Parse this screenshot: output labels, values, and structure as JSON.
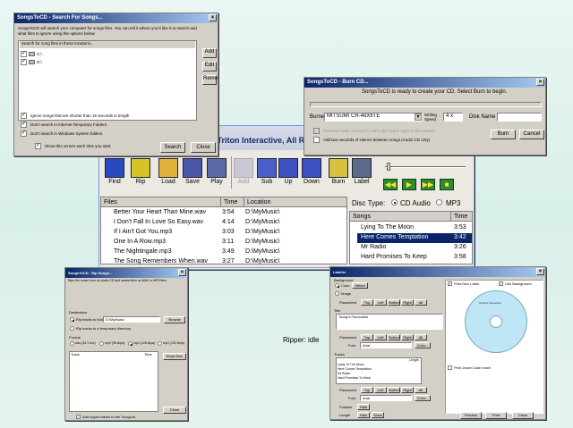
{
  "main": {
    "title_fragment": "4 Triton Interactive, All R",
    "toolbar": {
      "find": "Find",
      "rip": "Rip",
      "load": "Load",
      "save": "Save",
      "play": "Play",
      "add": "Add",
      "sub": "Sub",
      "up": "Up",
      "down": "Down",
      "burn": "Burn",
      "label": "Label"
    },
    "files": {
      "headers": [
        "Files",
        "Time",
        "Location"
      ],
      "rows": [
        [
          "Better Your Heart Than Mine.wav",
          "3:54",
          "D:\\MyMusic\\"
        ],
        [
          "I Don't Fall In Love So Easy.wav",
          "4:14",
          "D:\\MyMusic\\"
        ],
        [
          "If I Ain't Got You.mp3",
          "3:03",
          "D:\\MyMusic\\"
        ],
        [
          "One In A Row.mp3",
          "3:11",
          "D:\\MyMusic\\"
        ],
        [
          "The Nightingale.mp3",
          "3:49",
          "D:\\MyMusic\\"
        ],
        [
          "The Song Remembers When.wav",
          "3:27",
          "D:\\MyMusic\\"
        ]
      ]
    },
    "disc_type": {
      "label": "Disc Type:",
      "cd_audio": "CD Audio",
      "mp3": "MP3"
    },
    "songs": {
      "headers": [
        "Songs",
        "Time"
      ],
      "rows": [
        [
          "Lying To The Moon",
          "3:53"
        ],
        [
          "Here Comes Temptation",
          "3:42"
        ],
        [
          "Mr Radio",
          "3:26"
        ],
        [
          "Hard Promises To Keep",
          "3:58"
        ]
      ],
      "selected_index": 1
    },
    "status": "Ripper: idle"
  },
  "search": {
    "title": "SongsToCD - Search For Songs...",
    "intro": "SongsToCD will search your computer for songs files. You can tell it where you'd like it to search and what files to ignore using the options below",
    "list_header": "Search for song files in these locations...",
    "locations": [
      "C:\\",
      "D:\\"
    ],
    "add": "Add",
    "edit": "Edit",
    "remove": "Remove",
    "opt1": "Ignore songs that are shorter than 15 seconds in length",
    "opt2": "Don't search in Internet Temporary Folders",
    "opt3": "Don't search in Windows System folders",
    "opt4": "Show this screen each time you start",
    "search_btn": "Search",
    "close_btn": "Close"
  },
  "burn": {
    "title": "SongsToCD - Burn CD...",
    "ready": "SongsToCD is ready to create your CD. Select Burn to begin.",
    "burner_label": "Burner",
    "burner_value": "MITSUMI CR-48X8TE",
    "speed_label": "Writing Speed",
    "speed_value": "4 x",
    "disc_name_label": "Disk Name",
    "opt1": "Preserve order of songs in MP3 disc (adds digits to file names)",
    "opt2": "Add two seconds of silence between songs (Audio CD only)",
    "burn_btn": "Burn",
    "cancel_btn": "Cancel"
  },
  "rip": {
    "title": "SongsToCD - Rip Songs...",
    "intro": "Rips the music from an audio CD and saves them as WAV or MP3 files",
    "destination": "Destination",
    "rip_to_folder": "Rip tracks to folder",
    "folder": "D:\\MyMusic",
    "browse": "Browse",
    "temp": "Rip tracks to a temporary directory",
    "format": "Format",
    "formats": [
      "wav (44.1 khz)",
      "mp3 (96 kbps)",
      "mp3 (128 kbps)",
      "mp3 (192 kbps)"
    ],
    "track_col": "Track",
    "time_col": "Time",
    "read_disc": "Read Disc",
    "close": "Close",
    "add_tracks": "Add ripped tracks to the SongList"
  },
  "labeler": {
    "title": "Labeler",
    "background": "Background",
    "color": "Color",
    "image": "Image",
    "select": "Select",
    "placement": "Placement",
    "positions": [
      "Top",
      "Left",
      "Bottom",
      "Right",
      "All"
    ],
    "title_sec": "Title",
    "title_text": "Today's Favourites",
    "font_label": "Font",
    "font_value": "Arial",
    "color_btn": "Color...",
    "tracks": "Tracks",
    "track_list": [
      "Lying To The Moon",
      "Here Comes Temptation",
      "Mr Radio",
      "Hard Promises To Keep"
    ],
    "length_col": "Length",
    "position": "Position",
    "hide": "Hide",
    "show": "Show",
    "print_disc": "Print Disc Label",
    "use_bg": "Use Background",
    "print_jewel": "Print Jewel Case Insert",
    "preview": "Preview",
    "print": "Print",
    "close": "Close",
    "disc_text": "Today's Favourites"
  }
}
